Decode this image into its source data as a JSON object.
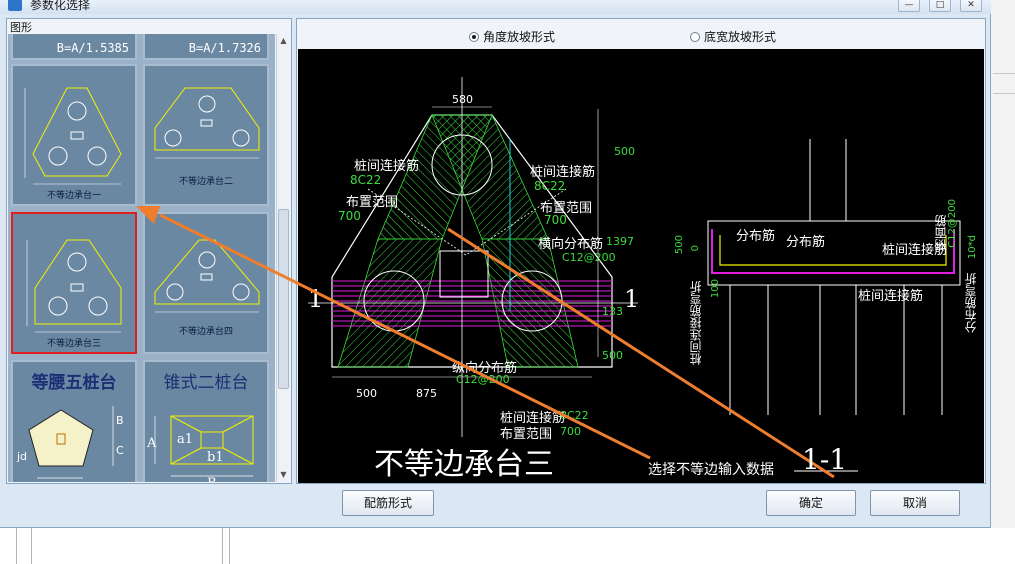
{
  "window": {
    "title": "参数化选择"
  },
  "left_panel": {
    "label": "图形",
    "thumbnails": [
      {
        "formula": "B=A/1.5385"
      },
      {
        "formula": "B=A/1.7326"
      },
      {
        "caption": "不等边承台一"
      },
      {
        "caption": "不等边承台二"
      },
      {
        "caption": "不等边承台三",
        "selected": true
      },
      {
        "caption": "不等边承台四"
      },
      {
        "title": "等腰五桩台",
        "labels": [
          "B",
          "C",
          "jd"
        ]
      },
      {
        "title": "锥式二桩台",
        "labels": [
          "A",
          "a1",
          "b1",
          "B"
        ]
      }
    ]
  },
  "right_panel": {
    "radio_options": [
      {
        "label": "角度放坡形式",
        "selected": true
      },
      {
        "label": "底宽放坡形式",
        "selected": false
      }
    ]
  },
  "drawing": {
    "title": "不等边承台三",
    "section_title": "1-1",
    "section_marks": [
      "1",
      "1"
    ],
    "dims_top": [
      "580",
      "500",
      "1397"
    ],
    "dims_bottom": [
      "500",
      "875"
    ],
    "dims_right": [
      "133",
      "500"
    ],
    "dims_section_left": [
      "500",
      "0",
      "100"
    ],
    "notes": {
      "left_rebar_name": "桩间连接筋",
      "left_rebar_spec": "8C22",
      "left_range": "布置范围",
      "left_range_value": "700",
      "right_rebar_name": "桩间连接筋",
      "right_rebar_spec": "8C22",
      "right_range": "布置范围",
      "right_range_value": "700",
      "horizontal_dist": "横向分布筋",
      "horizontal_spec": "C12@200",
      "vertical_dist": "纵向分布筋",
      "vertical_spec": "C12@200",
      "bottom_rebar_name": "桩间连接筋",
      "bottom_rebar_spec": "8C22",
      "bottom_range": "布置范围",
      "bottom_range_value": "700",
      "section_dist1": "分布筋",
      "section_dist2": "分布筋",
      "section_pile_connect": "桩间连接筋",
      "section_top_bar": "侧面筋",
      "section_top_spec": "C12@200",
      "section_bend": "10*d",
      "section_left_vertical": "桩间连接筋弯折",
      "section_right_vertical": "分布筋弯折",
      "section_bottom_connect": "桩间连接筋"
    },
    "annotation": "选择不等边输入数据"
  },
  "footer": {
    "rebar_form_button": "配筋形式",
    "ok_button": "确定",
    "cancel_button": "取消"
  },
  "colors": {
    "canvas_bg": "#000000",
    "hatch_green": "#3cdc3c",
    "hatch_magenta": "#e01ee0",
    "outline": "#ffffff",
    "yellow": "#f2f200",
    "arrow": "#ef7d2e"
  }
}
